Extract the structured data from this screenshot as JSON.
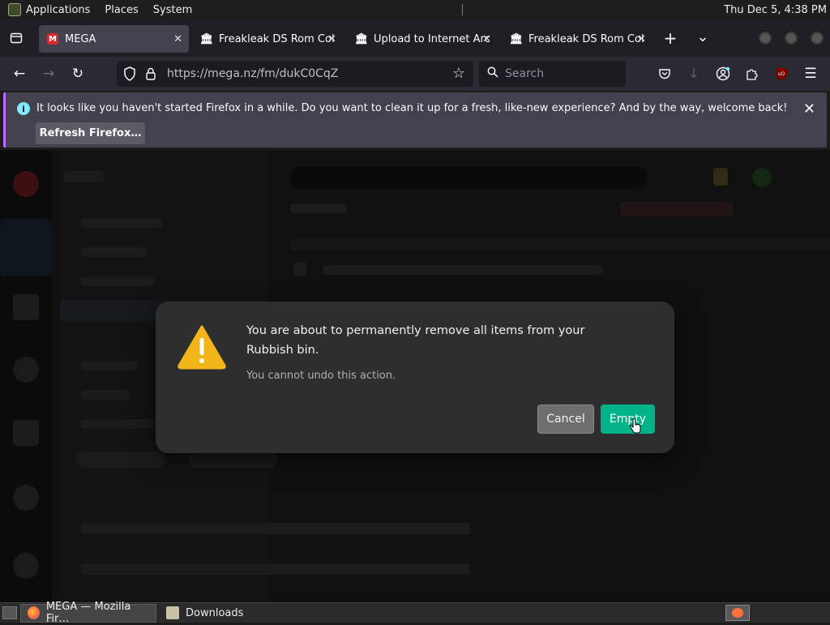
{
  "panel": {
    "menus": [
      "Applications",
      "Places",
      "System"
    ],
    "clock": "Thu Dec  5,  4:38 PM"
  },
  "tabs": [
    {
      "title": "MEGA",
      "favicon": "mega-logo",
      "active": true
    },
    {
      "title": "Freakleak DS Rom Col",
      "favicon": "internet-archive-icon",
      "active": false
    },
    {
      "title": "Upload to Internet Arc",
      "favicon": "internet-archive-icon",
      "active": false
    },
    {
      "title": "Freakleak DS Rom Col",
      "favicon": "internet-archive-icon",
      "active": false
    }
  ],
  "tabstrip": {
    "new_tab": "+",
    "list_tabs": "⌄"
  },
  "navbar": {
    "url": "https://mega.nz/fm/dukC0CqZ",
    "search_placeholder": "Search"
  },
  "notification": {
    "message": "It looks like you haven't started Firefox in a while. Do you want to clean it up for a fresh, like-new experience? And by the way, welcome back!",
    "button": "Refresh Firefox…",
    "info_glyph": "i",
    "close_glyph": "✕"
  },
  "dialog": {
    "heading": "You are about to permanently remove all items from your Rubbish bin.",
    "subtext": "You cannot undo this action.",
    "cancel": "Cancel",
    "confirm": "Empty",
    "warning_icon": "warning-triangle-icon",
    "accent": "#00b389"
  },
  "taskbar": {
    "items": [
      {
        "label": "MEGA — Mozilla Fir…",
        "active": true
      },
      {
        "label": "Downloads",
        "active": false
      }
    ]
  }
}
